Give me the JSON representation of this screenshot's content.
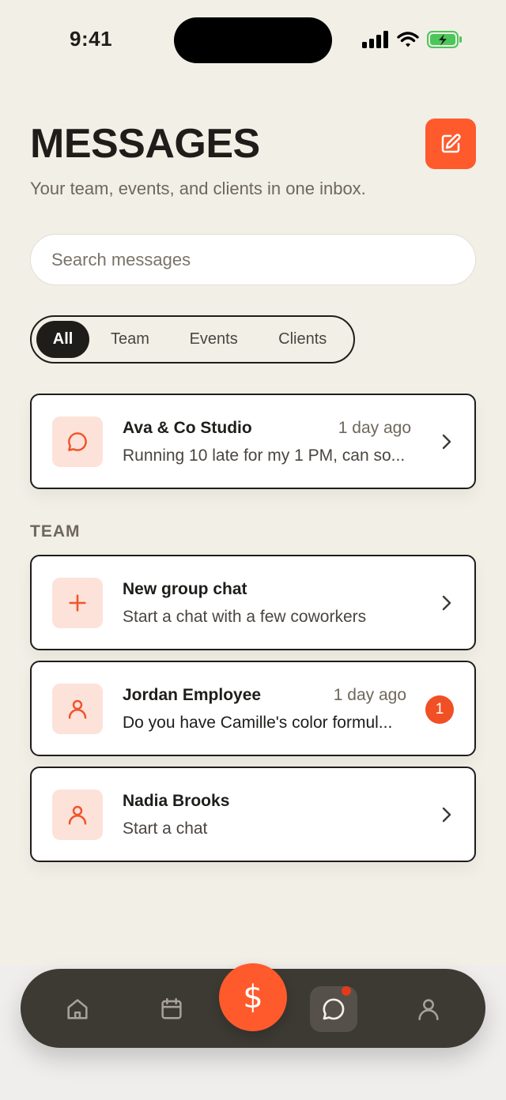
{
  "status_bar": {
    "time": "9:41"
  },
  "header": {
    "title": "MESSAGES",
    "subtitle": "Your team, events, and clients in one inbox.",
    "compose_icon": "compose-icon"
  },
  "search": {
    "placeholder": "Search messages"
  },
  "tabs": [
    {
      "label": "All",
      "active": true
    },
    {
      "label": "Team",
      "active": false
    },
    {
      "label": "Events",
      "active": false
    },
    {
      "label": "Clients",
      "active": false
    }
  ],
  "recent": {
    "title": "Ava & Co Studio",
    "time": "1 day ago",
    "preview": "Running 10 late for my 1 PM, can so...",
    "icon": "chat-bubble-icon"
  },
  "team": {
    "section_label": "TEAM",
    "items": [
      {
        "title": "New group chat",
        "subtitle": "Start a chat with a few coworkers",
        "icon": "plus-icon"
      },
      {
        "title": "Jordan Employee",
        "time": "1 day ago",
        "subtitle": "Do you have Camille's color formul...",
        "unread": "1",
        "icon": "user-icon"
      },
      {
        "title": "Nadia Brooks",
        "subtitle": "Start a chat",
        "icon": "user-icon"
      }
    ]
  },
  "bottom_nav": {
    "items": [
      "home-icon",
      "calendar-icon",
      "dollar-icon",
      "chat-icon",
      "profile-icon"
    ],
    "pay_symbol": "$",
    "active": "chat-icon"
  },
  "colors": {
    "accent": "#ff5a2c",
    "background": "#f2efe7",
    "dark": "#1f1d1a",
    "nav": "#3d3a34",
    "icon_tint": "#fde2d9"
  }
}
